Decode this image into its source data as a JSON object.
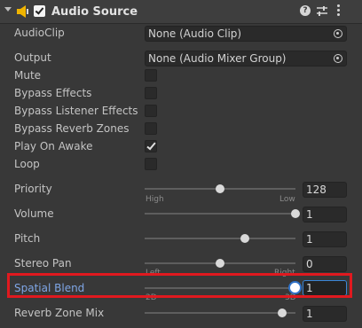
{
  "component": {
    "title": "Audio Source",
    "enabled": true
  },
  "fields": {
    "audio_clip": {
      "label": "AudioClip",
      "value": "None (Audio Clip)"
    },
    "output": {
      "label": "Output",
      "value": "None (Audio Mixer Group)"
    },
    "mute": {
      "label": "Mute",
      "checked": false
    },
    "bypass_effects": {
      "label": "Bypass Effects",
      "checked": false
    },
    "bypass_listener_effects": {
      "label": "Bypass Listener Effects",
      "checked": false
    },
    "bypass_reverb_zones": {
      "label": "Bypass Reverb Zones",
      "checked": false
    },
    "play_on_awake": {
      "label": "Play On Awake",
      "checked": true
    },
    "loop": {
      "label": "Loop",
      "checked": false
    },
    "priority": {
      "label": "Priority",
      "value": "128",
      "min_label": "High",
      "max_label": "Low",
      "level": 0.5
    },
    "volume": {
      "label": "Volume",
      "value": "1",
      "level": 1.0
    },
    "pitch": {
      "label": "Pitch",
      "value": "1",
      "level": 0.667
    },
    "stereo_pan": {
      "label": "Stereo Pan",
      "value": "0",
      "min_label": "Left",
      "max_label": "Right",
      "level": 0.5
    },
    "spatial_blend": {
      "label": "Spatial Blend",
      "value": "1",
      "min_label": "2D",
      "max_label": "3D",
      "level": 1.0
    },
    "reverb_zone_mix": {
      "label": "Reverb Zone Mix",
      "value": "1",
      "level": 0.909
    }
  },
  "colors": {
    "background": "#383838",
    "highlight_label": "#7fa6e6",
    "focus_border": "#3b86d6",
    "annotation_box": "#e0191f"
  },
  "icons": {
    "fold": "triangle-down-icon",
    "component": "speaker-icon",
    "help": "help-icon",
    "presets": "preset-icon",
    "menu": "kebab-menu-icon",
    "object_picker": "object-picker-icon"
  }
}
